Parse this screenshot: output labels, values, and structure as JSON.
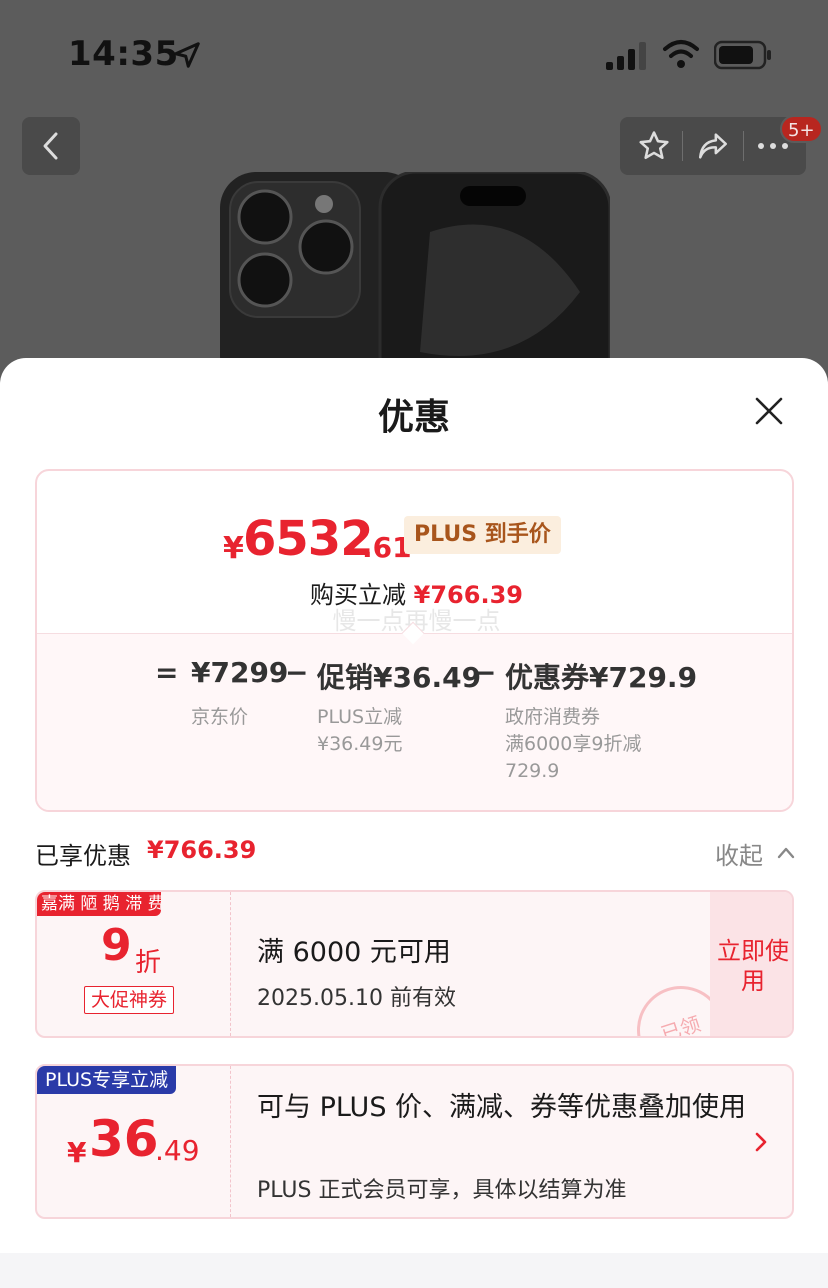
{
  "status_bar": {
    "time": "14:35"
  },
  "header": {
    "badge": "5+"
  },
  "sheet": {
    "title": "优惠",
    "price": {
      "yen": "¥",
      "integer": "6532",
      "decimal": ".61",
      "tag": "PLUS 到手价"
    },
    "save": {
      "label": "购买立减",
      "amount": "¥766.39"
    },
    "watermark": "慢一点再慢一点",
    "breakdown": {
      "equals": "=",
      "minus": "−",
      "items": [
        {
          "value": "¥7299",
          "note": "京东价"
        },
        {
          "value": "促销¥36.49",
          "note": "PLUS立减\n¥36.49元"
        },
        {
          "value": "优惠券¥729.9",
          "note": "政府消费券\n满6000享9折减\n729.9"
        }
      ]
    },
    "enjoyed": {
      "label": "已享优惠",
      "amount": "¥766.39",
      "collapse": "收起"
    },
    "coupon1": {
      "ribbon": "嘉满 陋 鹅 滞 费",
      "discount": "9",
      "unit": "折",
      "tag": "大促神券",
      "title": "满 6000 元可用",
      "validity": "2025.05.10 前有效",
      "use_button": "立即使用",
      "stamp": "已领"
    },
    "coupon2": {
      "ribbon": "PLUS专享立减",
      "yen": "¥",
      "integer": "36",
      "decimal": ".49",
      "title": "可与 PLUS 价、满减、券等优惠叠加使用",
      "subtitle": "PLUS 正式会员可享，具体以结算为准"
    }
  },
  "colors": {
    "accent": "#e8232f",
    "plus_blue": "#2a3aa8",
    "tag_bg": "#fbeede"
  }
}
